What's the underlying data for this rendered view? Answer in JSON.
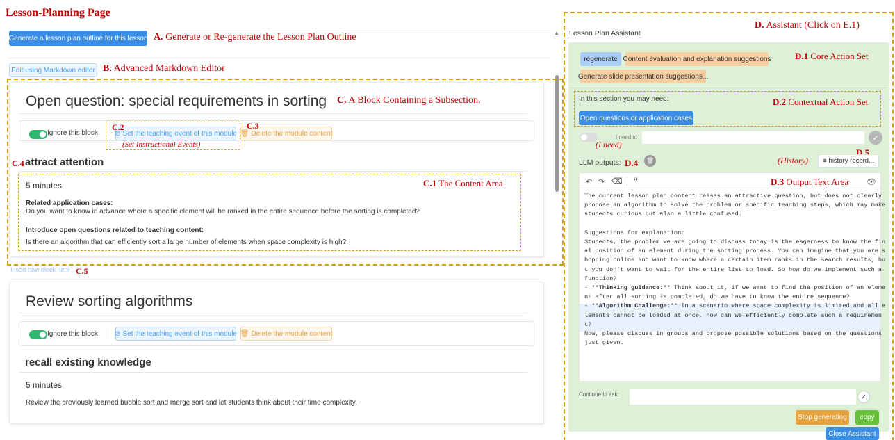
{
  "page_title": "Lesson-Planning Page",
  "left": {
    "generate_button": "Generate a lesson plan outline for this lesson",
    "edit_markdown_button": "Edit using Markdown editor",
    "insert_new_block": "Insert new block here",
    "blocks": [
      {
        "title": "Open question: special requirements in sorting",
        "ignore_label": "Ignore this block",
        "teach_button": "Set the teaching event of this module",
        "delete_button": "Delete the module content",
        "event_title": "attract attention",
        "duration": "5 minutes",
        "para1_head": "Related application cases:",
        "para1_text": "Do you want to know in advance where a specific element will be ranked in the entire sequence before the sorting is completed?",
        "para2_head": "Introduce open questions related to teaching content:",
        "para2_text": "Is there an algorithm that can efficiently sort a large number of elements when space complexity is high?"
      },
      {
        "title": "Review sorting algorithms",
        "ignore_label": "Ignore this block",
        "teach_button": "Set the teaching event of this module",
        "delete_button": "Delete the module content",
        "event_title": "recall existing knowledge",
        "duration": "5 minutes",
        "text": "Review the previously learned bubble sort and merge sort and let students think about their time complexity."
      }
    ]
  },
  "assistant": {
    "title": "Lesson Plan Assistant",
    "core_actions": [
      "regenerate",
      "Content evaluation and explanation suggestions",
      "Generate slide presentation suggestions..."
    ],
    "context_label": "In this section you may need:",
    "context_action": "Open questions or application cases",
    "need_label": "I need to",
    "llm_label": "LLM outputs:",
    "history_button": "history record...",
    "toolbar_quote": "“",
    "output_lines": [
      "The current lesson plan content raises an attractive question, but does not clearly",
      "propose an algorithm to solve the problem or specific teaching steps, which may make",
      "students curious but also a little confused.",
      "",
      "Suggestions for explanation:",
      "Students, the problem we are going to discuss today is the eagerness to know the fin",
      "al position of an element during the sorting process. You can imagine that you are s",
      "hopping online and want to know where a certain item ranks in the search results, bu",
      "t you don't want to wait for the entire list to load. So how do we implement such a",
      "function?",
      "- **Thinking guidance:** Think about it, if we want to find the position of an eleme",
      "nt after all sorting is completed, do we have to know the entire sequence?",
      "- **Algorithm Challenge:** In a scenario where space complexity is limited and all e",
      "lements cannot be loaded at once, how can we efficiently complete such a requiremen",
      "t?",
      "Now, please discuss in groups and propose possible solutions based on the questions",
      "just given."
    ],
    "continue_label": "Continue to ask:",
    "stop_button": "Stop generating",
    "copy_button": "copy",
    "close_button": "Close Assistant"
  },
  "annotations": {
    "A_letter": "A.",
    "A_text": "Generate or Re-generate the Lesson Plan Outline",
    "B_letter": "B.",
    "B_text": "Advanced Markdown Editor",
    "C_letter": "C.",
    "C_text": "A Block Containing a Subsection.",
    "C1_letter": "C.1",
    "C1_text": "The Content Area",
    "C2": "C.2",
    "C2_sub": "(Set Instructional Events)",
    "C3": "C.3",
    "C4": "C.4",
    "C5": "C.5",
    "D_letter": "D.",
    "D_text": "Assistant (Click on E.1)",
    "D1_letter": "D.1",
    "D1_text": "Core Action Set",
    "D2_letter": "D.2",
    "D2_text": "Contextual Action Set",
    "D3_letter": "D.3",
    "D3_text": "Output Text Area",
    "D4": "D.4",
    "D5": "D.5",
    "I_need": "(I need)",
    "History": "(History)"
  },
  "colors": {
    "annotation_red": "#c00000",
    "dash_gold": "#d4a017",
    "primary_blue": "#3a8ee6",
    "assistant_green": "#dff0d8",
    "chip_blue": "#a9cdf5",
    "chip_orange": "#f6cfa3",
    "stop_orange": "#e6a23c",
    "copy_green": "#67c23a"
  }
}
